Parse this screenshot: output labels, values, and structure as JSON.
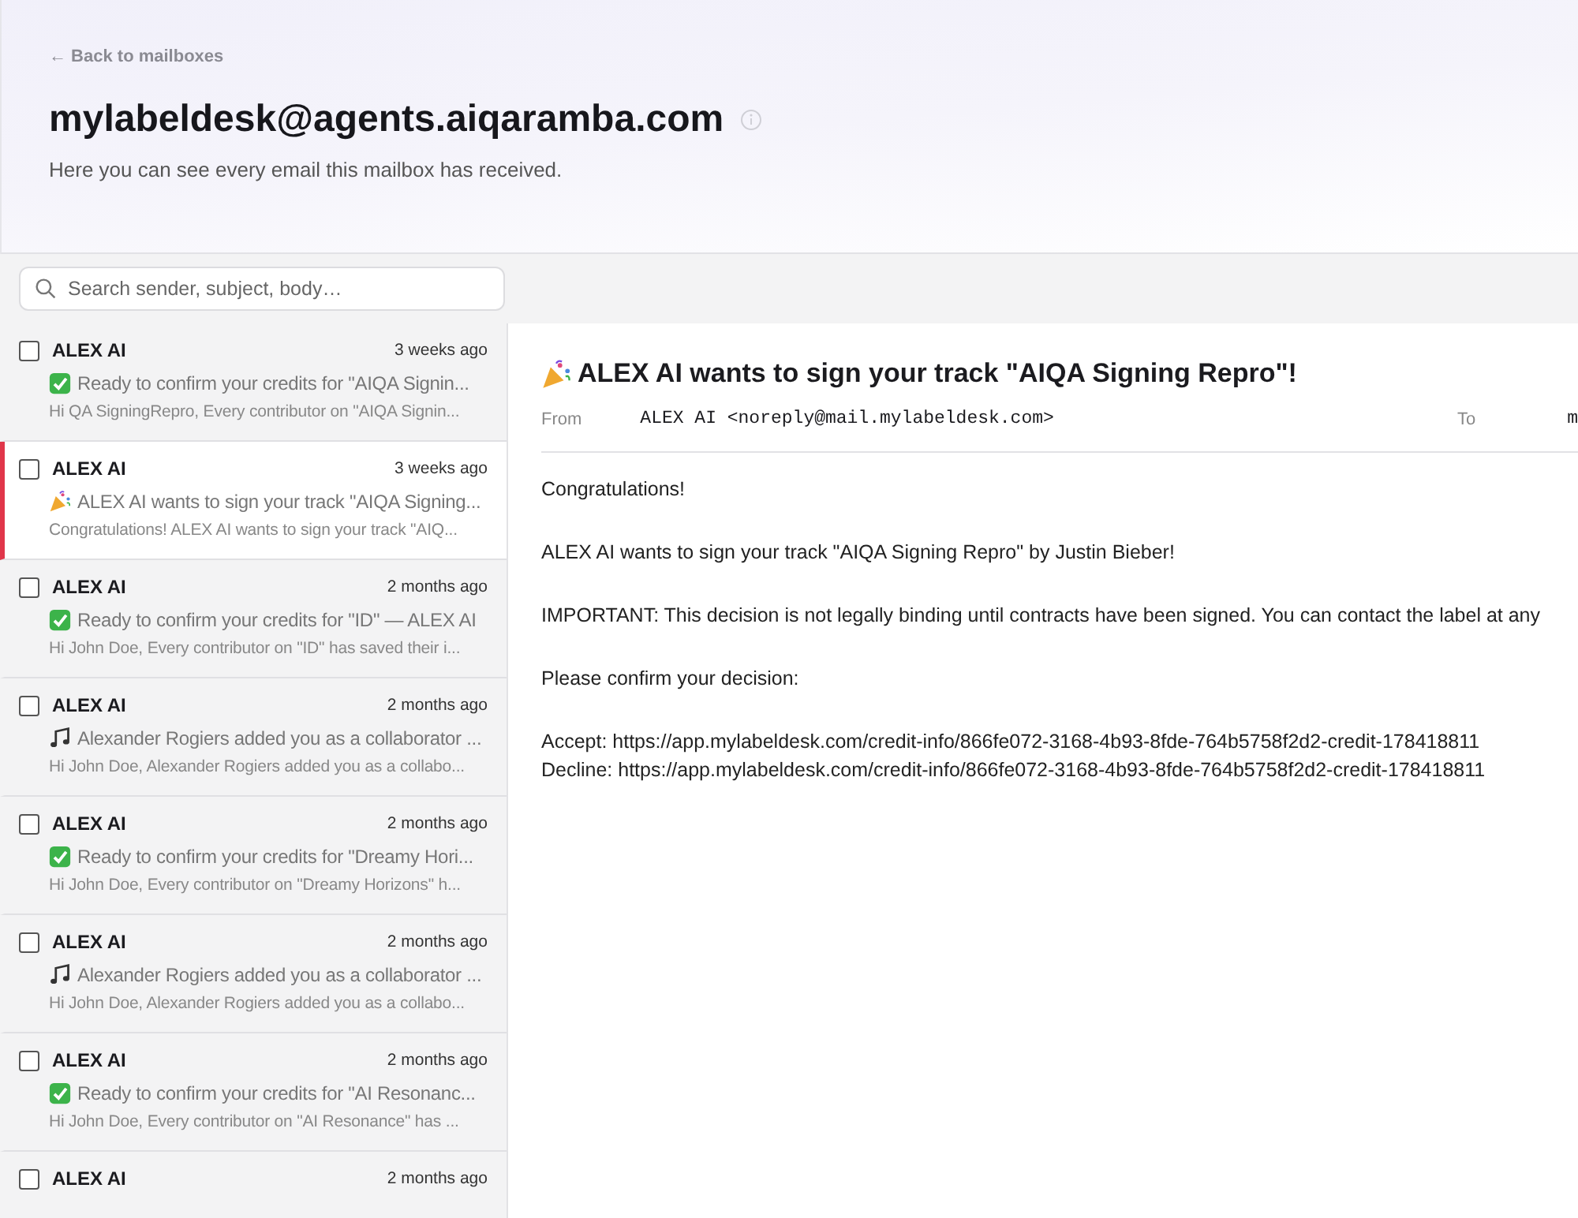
{
  "header": {
    "back_link": "← Back to mailboxes",
    "title": "mylabeldesk@agents.aiqaramba.com",
    "subtitle": "Here you can see every email this mailbox has received."
  },
  "search": {
    "placeholder": "Search sender, subject, body…"
  },
  "messages": [
    {
      "sender": "ALEX AI",
      "time": "3 weeks ago",
      "kind": "check",
      "subject": "Ready to confirm your credits for \"AIQA Signin...",
      "preview": "Hi QA SigningRepro, Every contributor on \"AIQA Signin...",
      "checked": false,
      "selected": false
    },
    {
      "sender": "ALEX AI",
      "time": "3 weeks ago",
      "kind": "party",
      "subject": "ALEX AI wants to sign your track \"AIQA Signing...",
      "preview": "Congratulations! ALEX AI wants to sign your track \"AIQ...",
      "checked": false,
      "selected": true
    },
    {
      "sender": "ALEX AI",
      "time": "2 months ago",
      "kind": "check",
      "subject": "Ready to confirm your credits for \"ID\" — ALEX AI",
      "preview": "Hi John Doe, Every contributor on \"ID\" has saved their i...",
      "checked": false,
      "selected": false
    },
    {
      "sender": "ALEX AI",
      "time": "2 months ago",
      "kind": "note",
      "subject": "Alexander Rogiers added you as a collaborator ...",
      "preview": "Hi John Doe, Alexander Rogiers added you as a collabo...",
      "checked": false,
      "selected": false
    },
    {
      "sender": "ALEX AI",
      "time": "2 months ago",
      "kind": "check",
      "subject": "Ready to confirm your credits for \"Dreamy Hori...",
      "preview": "Hi John Doe, Every contributor on \"Dreamy Horizons\" h...",
      "checked": false,
      "selected": false
    },
    {
      "sender": "ALEX AI",
      "time": "2 months ago",
      "kind": "note",
      "subject": "Alexander Rogiers added you as a collaborator ...",
      "preview": "Hi John Doe, Alexander Rogiers added you as a collabo...",
      "checked": false,
      "selected": false
    },
    {
      "sender": "ALEX AI",
      "time": "2 months ago",
      "kind": "check",
      "subject": "Ready to confirm your credits for \"AI Resonanc...",
      "preview": "Hi John Doe, Every contributor on \"AI Resonance\" has ...",
      "checked": false,
      "selected": false
    },
    {
      "sender": "ALEX AI",
      "time": "2 months ago",
      "checked": false,
      "selected": false
    }
  ],
  "detail": {
    "kind": "party",
    "subject": "ALEX AI wants to sign your track \"AIQA Signing Repro\"!",
    "from_label": "From",
    "from": "ALEX AI <noreply@mail.mylabeldesk.com>",
    "to_label": "To",
    "to": "m",
    "body": [
      "Congratulations!",
      "ALEX AI wants to sign your track \"AIQA Signing Repro\" by Justin Bieber!",
      "IMPORTANT: This decision is not legally binding until contracts have been signed. You can contact the label at any",
      "Please confirm your decision:"
    ],
    "links": [
      "Accept: https://app.mylabeldesk.com/credit-info/866fe072-3168-4b93-8fde-764b5758f2d2-credit-178418811",
      "Decline: https://app.mylabeldesk.com/credit-info/866fe072-3168-4b93-8fde-764b5758f2d2-credit-178418811"
    ]
  }
}
